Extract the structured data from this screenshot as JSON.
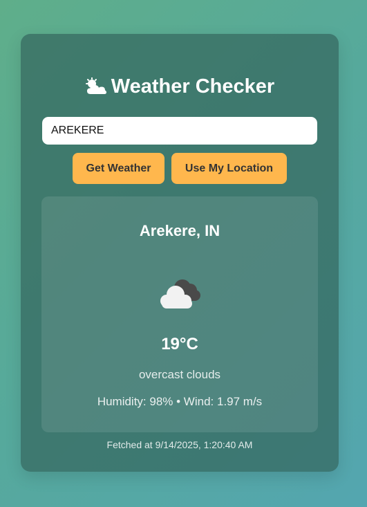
{
  "app": {
    "title": "Weather Checker",
    "title_icon": "sun-behind-cloud-icon"
  },
  "search": {
    "value": "AREKERE"
  },
  "buttons": {
    "get_weather": "Get Weather",
    "use_location": "Use My Location"
  },
  "result": {
    "location": "Arekere, IN",
    "icon": "overcast-clouds-icon",
    "temperature": "19°C",
    "description": "overcast clouds",
    "details": "Humidity: 98% • Wind: 1.97 m/s"
  },
  "footer": {
    "fetched": "Fetched at 9/14/2025, 1:20:40 AM"
  },
  "colors": {
    "button_bg": "#ffb74d",
    "button_text": "#333333",
    "card_bg": "#34665e",
    "text": "#ffffff"
  }
}
